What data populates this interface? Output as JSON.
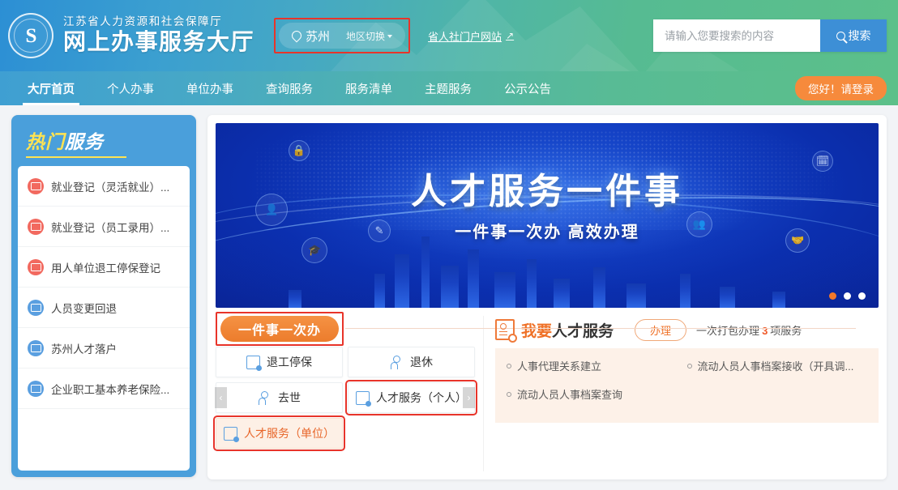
{
  "header": {
    "org_name": "江苏省人力资源和社会保障厅",
    "site_name": "网上办事服务大厅",
    "logo_letter": "S",
    "city": "苏州",
    "city_switch": "地区切换",
    "portal_link": "省人社门户网站",
    "portal_arrow": "↗",
    "search_placeholder": "请输入您要搜索的内容",
    "search_value": "",
    "search_button": "搜索"
  },
  "nav": {
    "items": [
      {
        "label": "大厅首页",
        "active": true
      },
      {
        "label": "个人办事",
        "active": false
      },
      {
        "label": "单位办事",
        "active": false
      },
      {
        "label": "查询服务",
        "active": false
      },
      {
        "label": "服务清单",
        "active": false
      },
      {
        "label": "主题服务",
        "active": false
      },
      {
        "label": "公示公告",
        "active": false
      }
    ],
    "login_label": "您好！请登录"
  },
  "sidebar": {
    "title_highlight": "热门",
    "title_rest": "服务",
    "items": [
      {
        "label": "就业登记（灵活就业）...",
        "color": "red"
      },
      {
        "label": "就业登记（员工录用）...",
        "color": "red"
      },
      {
        "label": "用人单位退工停保登记",
        "color": "red"
      },
      {
        "label": "人员变更回退",
        "color": "blue"
      },
      {
        "label": "苏州人才落户",
        "color": "blue"
      },
      {
        "label": "企业职工基本养老保险...",
        "color": "blue"
      }
    ]
  },
  "banner": {
    "title": "人才服务一件事",
    "subtitle": "一件事一次办 高效办理",
    "dots": [
      {
        "active": true
      },
      {
        "active": false
      },
      {
        "active": false
      }
    ]
  },
  "tabs": {
    "pill_label": "一件事一次办",
    "prev_arrow": "‹",
    "next_arrow": "›",
    "cells": [
      {
        "label": "退工停保",
        "selected": false,
        "highlighted": false,
        "icon": "doc-icon"
      },
      {
        "label": "退休",
        "selected": false,
        "highlighted": false,
        "icon": "person-icon"
      },
      {
        "label": "去世",
        "selected": false,
        "highlighted": false,
        "icon": "person-icon"
      },
      {
        "label": "人才服务（个人）",
        "selected": false,
        "highlighted": true,
        "icon": "doc-icon"
      },
      {
        "label": "人才服务（单位）",
        "selected": true,
        "highlighted": true,
        "icon": "doc-icon"
      }
    ]
  },
  "service_panel": {
    "title_highlight": "我要",
    "title_rest": "人才服务",
    "action_label": "办理",
    "count_prefix": "一次打包办理",
    "count": "3",
    "count_suffix": "项服务",
    "items": [
      "人事代理关系建立",
      "流动人员人事档案接收（开具调...",
      "流动人员人事档案查询"
    ]
  }
}
